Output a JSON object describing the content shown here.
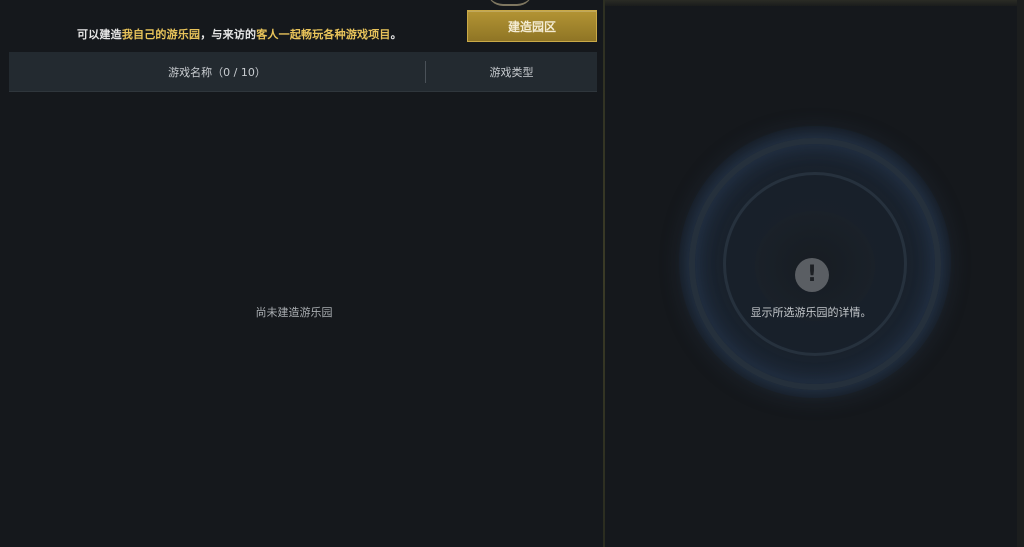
{
  "info_bar": {
    "text_part1": "可以建造",
    "text_highlight1": "我自己的游乐园",
    "text_part2": "，与来访的",
    "text_highlight2": "客人一起畅玩各种游戏项目",
    "text_part3": "。",
    "build_button_label": "建造园区"
  },
  "table": {
    "col_name_label": "游戏名称（0 / 10）",
    "col_type_label": "游戏类型",
    "empty_message": "尚未建造游乐园"
  },
  "detail_panel": {
    "icon": "alert-icon",
    "icon_glyph": "!",
    "message": "显示所选游乐园的详情。"
  },
  "colors": {
    "accent": "#e8c35a",
    "button": "#a08530",
    "background": "#15181c"
  }
}
